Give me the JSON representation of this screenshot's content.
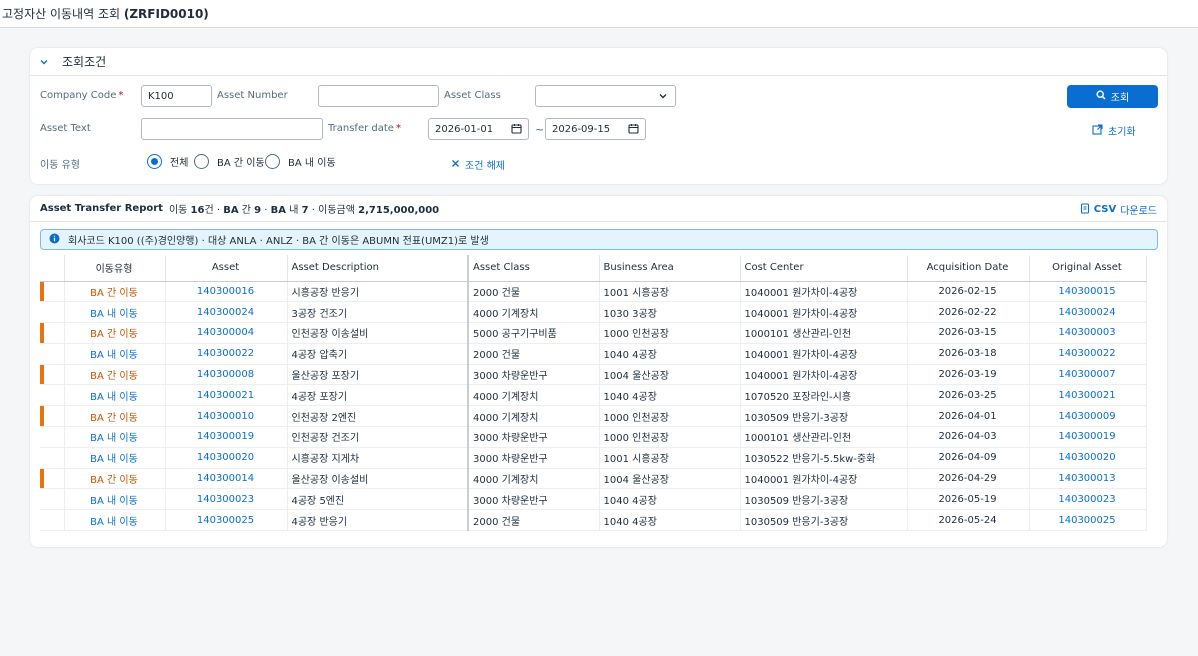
{
  "app": {
    "title_prefix": "고정자산 이동내역 조회",
    "title_code": "(ZRFID0010)"
  },
  "filter": {
    "section_label": "조회조건",
    "company_code_label": "Company Code",
    "company_code_value": "K100",
    "asset_number_label": "Asset Number",
    "asset_number_value": "",
    "asset_class_label": "Asset Class",
    "asset_class_value": "",
    "asset_text_label": "Asset Text",
    "asset_text_value": "",
    "transfer_date_label": "Transfer date",
    "date_from": "2026-01-01",
    "date_to": "2026-09-15",
    "tilde": "~",
    "move_type_label": "이동 유형",
    "radios": [
      "전체",
      "BA 간 이동",
      "BA 내 이동"
    ],
    "selected_radio": "전체",
    "clear_label": "조건 해제",
    "search_label": "조회",
    "reset_label": "초기화"
  },
  "report": {
    "title": "Asset Transfer Report",
    "summary_prefix": "이동",
    "summary_count": "16",
    "summary_unit": "건",
    "summary_inter_label": "BA",
    "summary_inter_suffix": "간",
    "summary_inter_count": "9",
    "summary_intra_label": "BA",
    "summary_intra_suffix": "내",
    "summary_intra_count": "7",
    "summary_amount_label": "이동금액",
    "summary_amount": "2,715,000,000",
    "csv_label": "CSV",
    "csv_suffix": "다운로드",
    "info_text": "회사코드 K100 ((주)경인양행) · 대상 ANLA · ANLZ · BA 간 이동은 ABUMN 전표(UMZ1)로 발생",
    "columns": [
      "이동유형",
      "Asset",
      "Asset Description",
      "Asset Class",
      "Business Area",
      "Cost Center",
      "Acquisition Date",
      "Original Asset"
    ],
    "rows": [
      {
        "type": "BA 간 이동",
        "inter": true,
        "asset": "140300016",
        "desc": "시흥공장 반응기",
        "class": "2000 건물",
        "ba": "1001 시흥공장",
        "cc": "1040001 원가차이-4공장",
        "acq": "2026-02-15",
        "orig": "140300015"
      },
      {
        "type": "BA 내 이동",
        "inter": false,
        "asset": "140300024",
        "desc": "3공장 건조기",
        "class": "4000 기계장치",
        "ba": "1030 3공장",
        "cc": "1040001 원가차이-4공장",
        "acq": "2026-02-22",
        "orig": "140300024"
      },
      {
        "type": "BA 간 이동",
        "inter": true,
        "asset": "140300004",
        "desc": "인천공장 이송설비",
        "class": "5000 공구기구비품",
        "ba": "1000 인천공장",
        "cc": "1000101 생산관리-인천",
        "acq": "2026-03-15",
        "orig": "140300003"
      },
      {
        "type": "BA 내 이동",
        "inter": false,
        "asset": "140300022",
        "desc": "4공장 압축기",
        "class": "2000 건물",
        "ba": "1040 4공장",
        "cc": "1040001 원가차이-4공장",
        "acq": "2026-03-18",
        "orig": "140300022"
      },
      {
        "type": "BA 간 이동",
        "inter": true,
        "asset": "140300008",
        "desc": "울산공장 포장기",
        "class": "3000 차량운반구",
        "ba": "1004 울산공장",
        "cc": "1040001 원가차이-4공장",
        "acq": "2026-03-19",
        "orig": "140300007"
      },
      {
        "type": "BA 내 이동",
        "inter": false,
        "asset": "140300021",
        "desc": "4공장 포장기",
        "class": "4000 기계장치",
        "ba": "1040 4공장",
        "cc": "1070520 포장라인-시흥",
        "acq": "2026-03-25",
        "orig": "140300021"
      },
      {
        "type": "BA 간 이동",
        "inter": true,
        "asset": "140300010",
        "desc": "인천공장 2엔진",
        "class": "4000 기계장치",
        "ba": "1000 인천공장",
        "cc": "1030509 반응기-3공장",
        "acq": "2026-04-01",
        "orig": "140300009"
      },
      {
        "type": "BA 내 이동",
        "inter": false,
        "asset": "140300019",
        "desc": "인천공장 건조기",
        "class": "3000 차량운반구",
        "ba": "1000 인천공장",
        "cc": "1000101 생산관리-인천",
        "acq": "2026-04-03",
        "orig": "140300019"
      },
      {
        "type": "BA 내 이동",
        "inter": false,
        "asset": "140300020",
        "desc": "시흥공장 지게차",
        "class": "3000 차량운반구",
        "ba": "1001 시흥공장",
        "cc": "1030522 반응기-5.5kw-중화",
        "acq": "2026-04-09",
        "orig": "140300020"
      },
      {
        "type": "BA 간 이동",
        "inter": true,
        "asset": "140300014",
        "desc": "울산공장 이송설비",
        "class": "4000 기계장치",
        "ba": "1004 울산공장",
        "cc": "1040001 원가차이-4공장",
        "acq": "2026-04-29",
        "orig": "140300013"
      },
      {
        "type": "BA 내 이동",
        "inter": false,
        "asset": "140300023",
        "desc": "4공장 5엔진",
        "class": "3000 차량운반구",
        "ba": "1040 4공장",
        "cc": "1030509 반응기-3공장",
        "acq": "2026-05-19",
        "orig": "140300023"
      },
      {
        "type": "BA 내 이동",
        "inter": false,
        "asset": "140300025",
        "desc": "4공장 반응기",
        "class": "2000 건물",
        "ba": "1040 4공장",
        "cc": "1030509 반응기-3공장",
        "acq": "2026-05-24",
        "orig": "140300025"
      }
    ]
  },
  "colors": {
    "accent": "#0a6ed1",
    "inter_move": "#e9730c",
    "inter_text": "#c35500"
  },
  "icons": [
    "chevron-down-icon",
    "calendar-icon",
    "search-icon",
    "close-icon",
    "reset-icon",
    "info-icon",
    "csv-icon"
  ]
}
